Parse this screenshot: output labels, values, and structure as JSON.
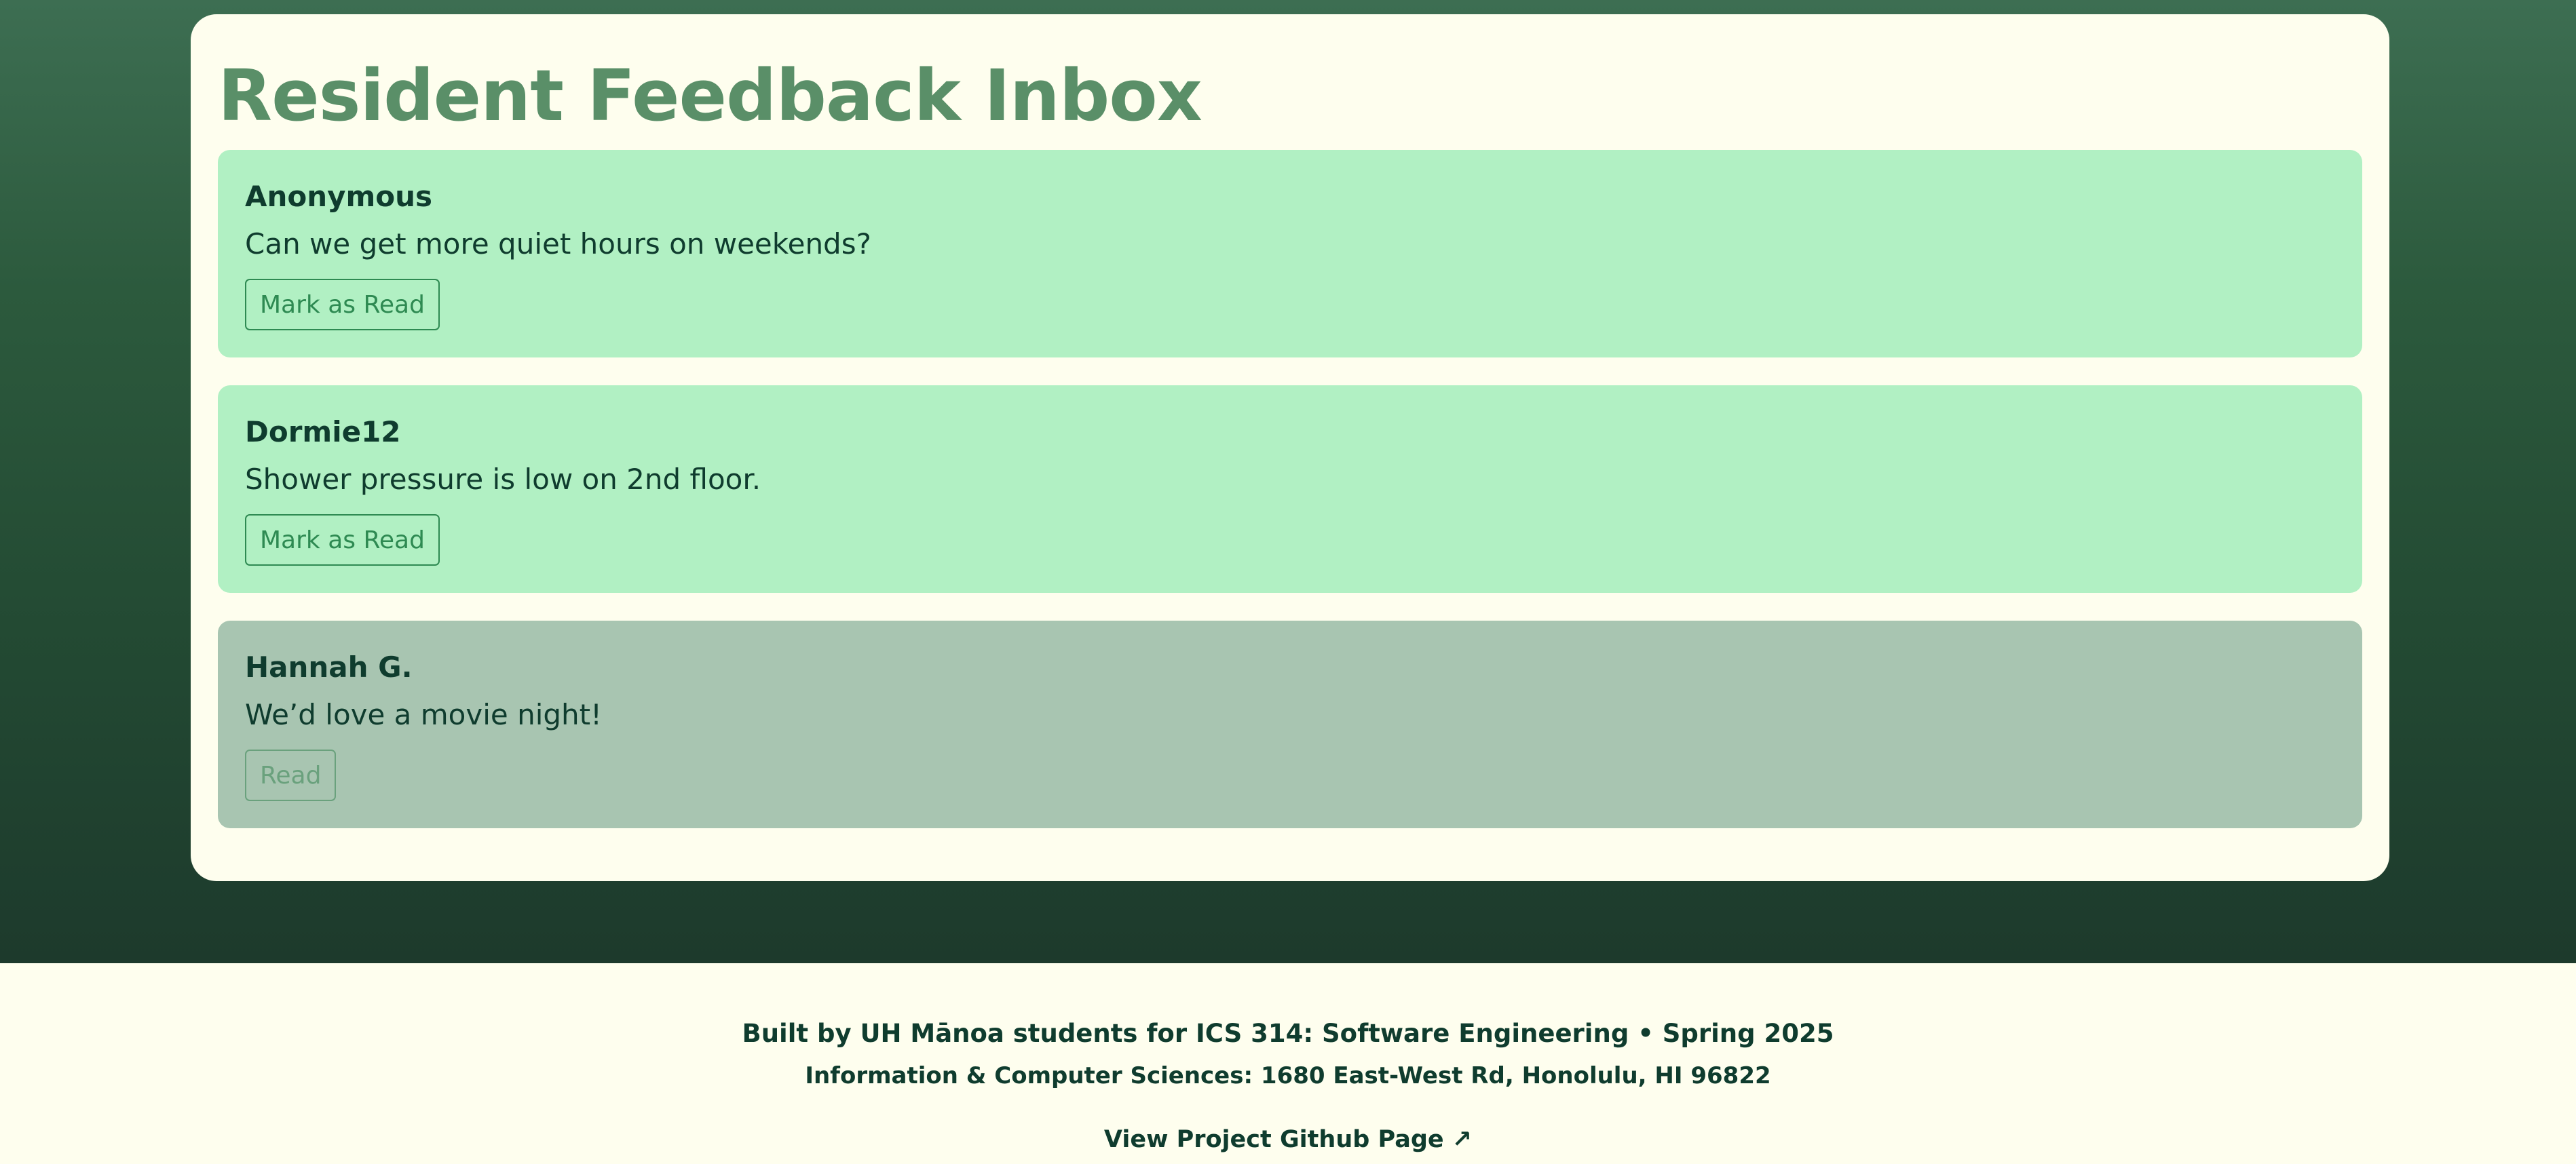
{
  "colors": {
    "accent": "#5a8f68",
    "unread_card": "#b1f0c3",
    "read_card": "#a8c5b1",
    "text_dark": "#0f3c2e",
    "button": "#2e8a52",
    "page_bg": "#fefeee"
  },
  "page": {
    "title": "Resident Feedback Inbox"
  },
  "feedback": [
    {
      "author": "Anonymous",
      "message": "Can we get more quiet hours on weekends?",
      "button_label": "Mark as Read",
      "status": "unread"
    },
    {
      "author": "Dormie12",
      "message": "Shower pressure is low on 2nd floor.",
      "button_label": "Mark as Read",
      "status": "unread"
    },
    {
      "author": "Hannah G.",
      "message": "We’d love a movie night!",
      "button_label": "Read",
      "status": "read"
    }
  ],
  "footer": {
    "credits": "Built by UH Mānoa students for ICS 314: Software Engineering • Spring 2025",
    "address": "Information & Computer Sciences: 1680 East-West Rd, Honolulu, HI 96822",
    "github_link": "View Project Github Page ↗"
  }
}
